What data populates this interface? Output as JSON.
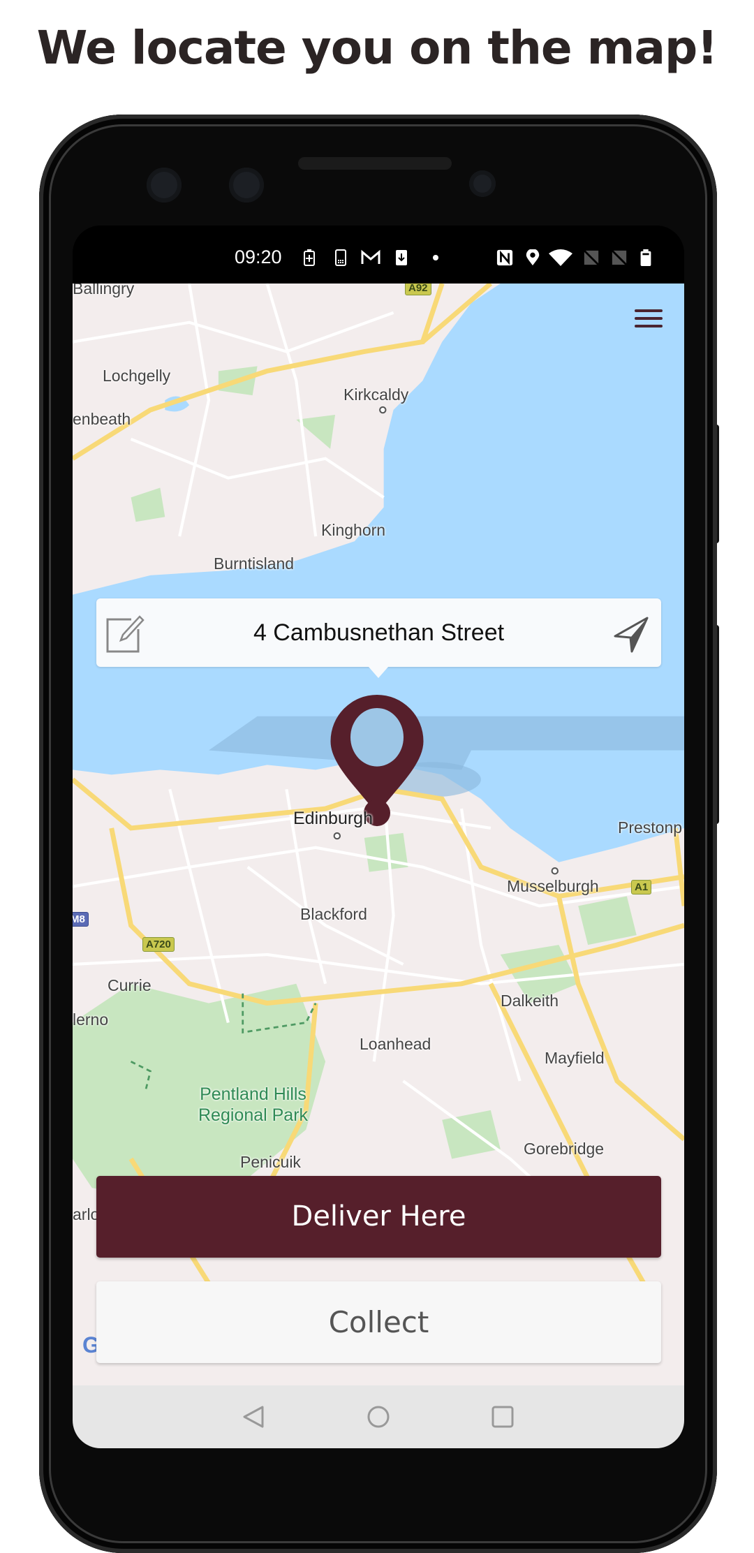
{
  "headline": "We locate you on the map!",
  "status_bar": {
    "time": "09:20",
    "icons": [
      "battery-saver-icon",
      "sim-icon",
      "gmail-icon",
      "download-icon",
      "dot-icon",
      "nfc-icon",
      "location-icon",
      "wifi-icon",
      "no-signal-icon",
      "no-signal-icon",
      "battery-icon"
    ]
  },
  "map": {
    "labels": {
      "ballingry": "Ballingry",
      "lochgelly": "Lochgelly",
      "cowdenbeath": "enbeath",
      "kirkcaldy": "Kirkcaldy",
      "kinghorn": "Kinghorn",
      "burntisland": "Burntisland",
      "edinburgh": "Edinburgh",
      "prestonpans": "Prestonp",
      "musselburgh": "Musselburgh",
      "blackford": "Blackford",
      "currie": "Currie",
      "balerno": "lerno",
      "dalkeith": "Dalkeith",
      "loanhead": "Loanhead",
      "mayfield": "Mayfield",
      "pentland_1": "Pentland Hills",
      "pentland_2": "Regional Park",
      "gorebridge": "Gorebridge",
      "penicuik": "Penicuik",
      "carlops": "arlons"
    },
    "road_shields": {
      "a92": "A92",
      "a720": "A720",
      "a1": "A1",
      "m8": "M8"
    },
    "attribution": "Google",
    "colors": {
      "land": "#f3eded",
      "water": "#aadaff",
      "park": "#c8e6c0",
      "major_road": "#f8d977"
    }
  },
  "menu_icon": "hamburger-menu-icon",
  "address_card": {
    "address": "4 Cambusnethan Street",
    "edit_icon": "edit-icon",
    "locate_icon": "navigation-arrow-icon"
  },
  "pin": {
    "icon": "map-pin-icon",
    "color": "#561f2b"
  },
  "buttons": {
    "deliver": "Deliver Here",
    "collect": "Collect"
  },
  "accent": "#561f2b",
  "nav_bar": {
    "back": "back-icon",
    "home": "home-icon",
    "recents": "recents-icon"
  }
}
